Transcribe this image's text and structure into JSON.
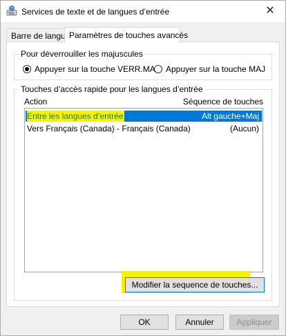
{
  "window": {
    "title": "Services de texte et de langues d’entrée",
    "close_glyph": "✕",
    "icon": "keyboard-globe-icon"
  },
  "tabs": [
    {
      "label": "Barre de langue",
      "active": false
    },
    {
      "label": "Paramètres de touches avancés",
      "active": true
    }
  ],
  "caps_group": {
    "label": "Pour déverrouiller les majuscules",
    "options": [
      {
        "label": "Appuyer sur la touche VERR.MAJ",
        "checked": true
      },
      {
        "label": "Appuyer sur la touche MAJ",
        "checked": false
      }
    ]
  },
  "hotkeys_group": {
    "label": "Touches d’accès rapide pour les langues d’entrée",
    "columns": {
      "action": "Action",
      "keys": "Séquence de touches"
    },
    "rows": [
      {
        "action": "Entre les langues d’entrée",
        "keys": "Alt gauche+Maj",
        "selected": true
      },
      {
        "action": "Vers Français (Canada) - Français (Canada)",
        "keys": "(Aucun)",
        "selected": false
      }
    ],
    "modify_button": "Modifier la sequence de touches..."
  },
  "footer": {
    "ok": "OK",
    "cancel": "Annuler",
    "apply": "Appliquer"
  },
  "colors": {
    "highlight": "#f4f400",
    "selection": "#0078d7",
    "selected_action_text": "#2d7b1c"
  }
}
